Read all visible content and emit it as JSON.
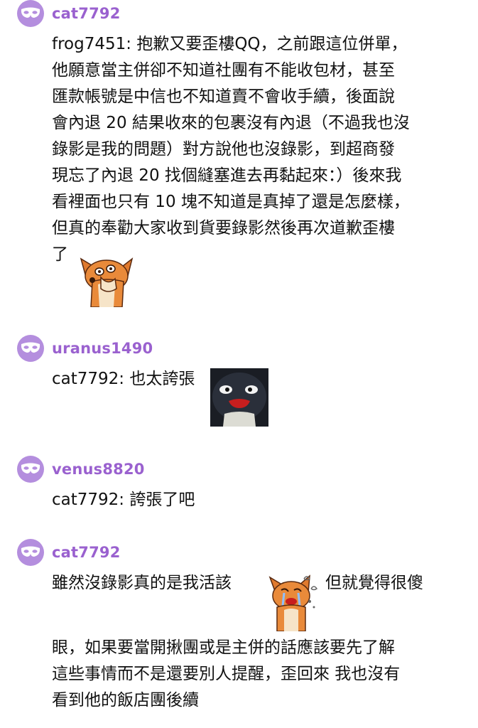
{
  "comments": [
    {
      "username": "cat7792",
      "lines": [
        "frog7451: 抱歉又要歪樓QQ，之前跟這位併單，",
        "他願意當主併卻不知道社團有不能收包材，甚至",
        "匯款帳號是中信也不知道賣不會收手續，後面說",
        "會內退 20 結果收來的包裹沒有內退（不過我也沒",
        "錄影是我的問題）對方說他也沒錄影，到超商發",
        "現忘了內退 20 找個縫塞進去再黏起來：）後來我",
        "看裡面也只有 10 塊不知道是真掉了還是怎麼樣，",
        "但真的奉勸大家收到貨要錄影然後再次道歉歪樓",
        "了"
      ],
      "sticker": "fox-hand-on-face-sticker"
    },
    {
      "username": "uranus1490",
      "lines": [
        "cat7792: 也太誇張"
      ],
      "sticker": "penguin-photo-sticker"
    },
    {
      "username": "venus8820",
      "lines": [
        "cat7792: 誇張了吧"
      ]
    },
    {
      "username": "cat7792",
      "lines": [
        "雖然沒錄影真的是我活該",
        "但就覺得很傻",
        "眼，如果要當開揪團或是主併的話應該要先了解",
        "這些事情而不是還要別人提醒，歪回來 我也沒有",
        "看到他的飯店團後續"
      ],
      "sticker": "fox-crying-sticker"
    }
  ],
  "colors": {
    "avatar": "#b48ede",
    "username": "#9a61cf",
    "text": "#111111"
  }
}
